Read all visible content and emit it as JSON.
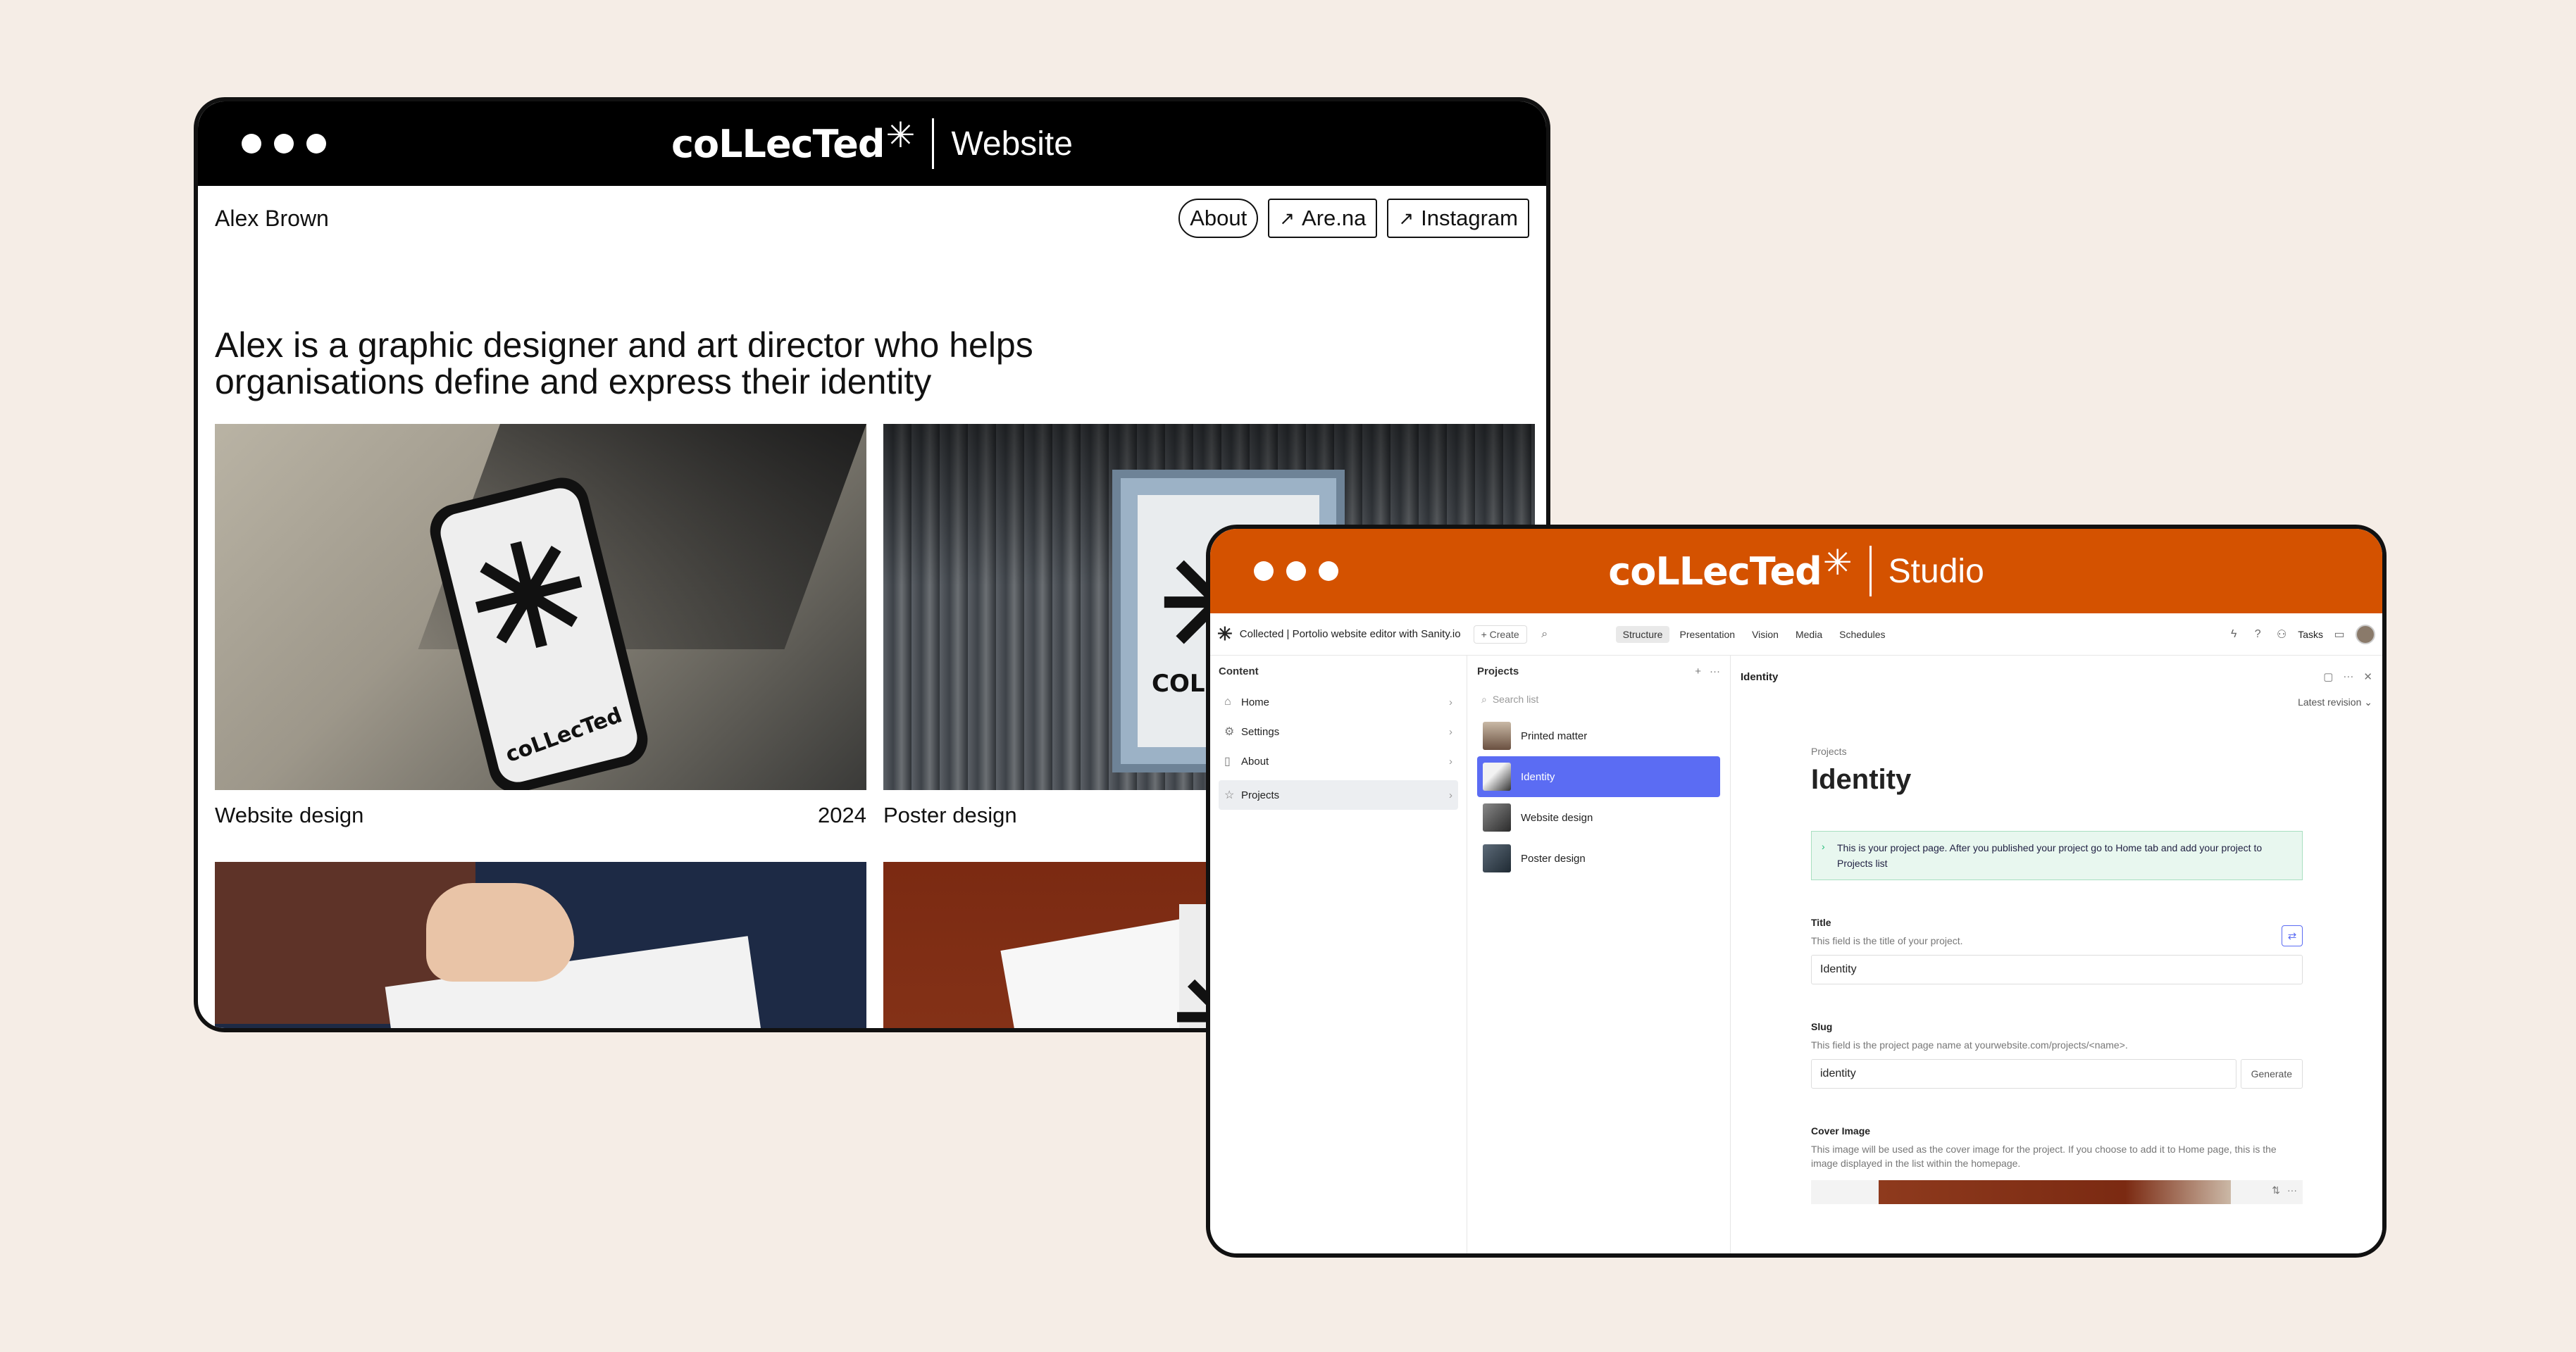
{
  "website_window": {
    "brand": "coLLecTed",
    "brand_star": "✳",
    "window_name": "Website",
    "owner": "Alex Brown",
    "nav": [
      {
        "label": "About",
        "icon": ""
      },
      {
        "label": "Are.na",
        "icon": "arrow-up-right-icon"
      },
      {
        "label": "Instagram",
        "icon": "arrow-up-right-icon"
      }
    ],
    "tagline": "Alex is a graphic designer and art director who helps organisations define and express their identity",
    "cards": [
      {
        "title": "Website design",
        "year": "2024",
        "phone_word": "coLLecTed",
        "star": "✳"
      },
      {
        "title": "Poster design",
        "year": "",
        "board_word": "COLL",
        "star": "✳"
      },
      {
        "title": "",
        "year": ""
      },
      {
        "title": "",
        "year": "",
        "star": "✳"
      }
    ]
  },
  "studio_window": {
    "brand": "coLLecTed",
    "brand_star": "✳",
    "window_name": "Studio",
    "toolbar": {
      "logo": "✳",
      "title": "Collected | Portolio website editor with Sanity.io",
      "create": "+ Create",
      "tabs": [
        "Structure",
        "Presentation",
        "Vision",
        "Media",
        "Schedules"
      ],
      "active_tab": "Structure",
      "tasks": "Tasks"
    },
    "content_pane": {
      "heading": "Content",
      "items": [
        {
          "label": "Home",
          "icon": "home-icon"
        },
        {
          "label": "Settings",
          "icon": "gear-icon"
        },
        {
          "label": "About",
          "icon": "book-icon"
        },
        {
          "label": "Projects",
          "icon": "star-icon"
        }
      ]
    },
    "projects_pane": {
      "heading": "Projects",
      "search_placeholder": "Search list",
      "items": [
        "Printed matter",
        "Identity",
        "Website design",
        "Poster design"
      ],
      "selected": "Identity"
    },
    "document": {
      "heading": "Identity",
      "revision": "Latest revision",
      "breadcrumb": "Projects",
      "title": "Identity",
      "note": "This is your project page. After you published your project go to Home tab and add your project to Projects list",
      "fields": {
        "title": {
          "label": "Title",
          "description": "This field is the title of your project.",
          "value": "Identity"
        },
        "slug": {
          "label": "Slug",
          "description": "This field is the project page name at yourwebsite.com/projects/<name>.",
          "value": "identity",
          "button": "Generate"
        },
        "cover": {
          "label": "Cover Image",
          "description": "This image will be used as the cover image for the project. If you choose to add it to Home page, this is the image displayed in the list within the homepage."
        }
      }
    }
  },
  "colors": {
    "background": "#f5ede6",
    "website_bar": "#000000",
    "studio_bar": "#d45200",
    "selection": "#5b6cf3"
  }
}
